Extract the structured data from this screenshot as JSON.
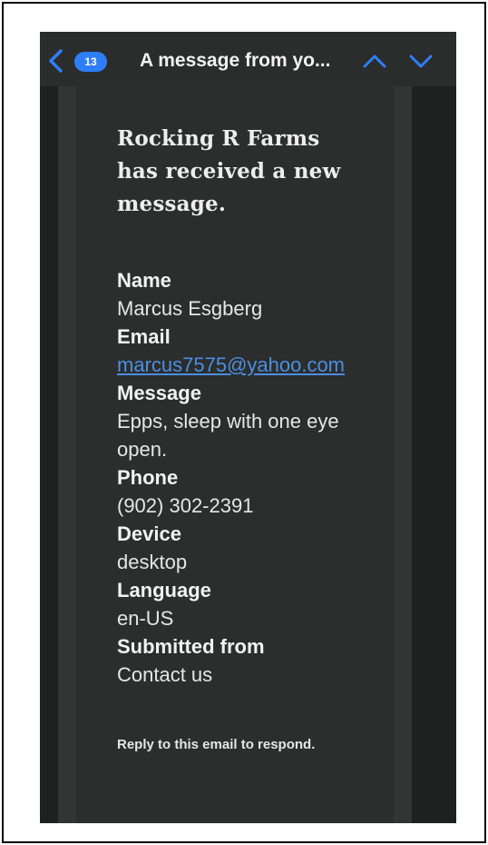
{
  "header": {
    "badge_count": "13",
    "title": "A message from yo..."
  },
  "message": {
    "headline_line1": "Rocking R Farms",
    "headline_line2": "has received a new",
    "headline_line3": "message.",
    "fields": [
      {
        "label": "Name",
        "value": "Marcus Esgberg"
      },
      {
        "label": "Email",
        "value": "marcus7575@yahoo.com"
      },
      {
        "label": "Message",
        "value": "Epps, sleep with one eye open."
      },
      {
        "label": "Phone",
        "value": "(902) 302-2391"
      },
      {
        "label": "Device",
        "value": "desktop"
      },
      {
        "label": "Language",
        "value": "en-US"
      },
      {
        "label": "Submitted from",
        "value": "Contact us"
      }
    ],
    "footer": "Reply to this email to respond."
  },
  "colors": {
    "accent": "#2e7ff7",
    "link": "#4a90e2",
    "background": "#2c2d2d"
  },
  "icons": {
    "back": "chevron-left-icon",
    "previous": "chevron-up-icon",
    "next": "chevron-down-icon"
  }
}
